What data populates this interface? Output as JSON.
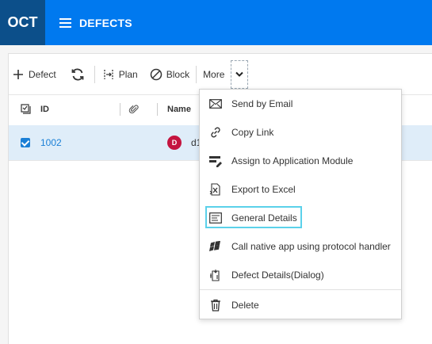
{
  "header": {
    "app_logo": "OCT",
    "module_title": "DEFECTS",
    "brand_color": "#0079ef",
    "logo_bg": "#0c4f8a"
  },
  "toolbar": {
    "add_label": "Defect",
    "plan_label": "Plan",
    "block_label": "Block",
    "more_label": "More"
  },
  "grid": {
    "columns": [
      "ID",
      "Name"
    ],
    "rows": [
      {
        "id": "1002",
        "avatar_initial": "D",
        "name_partial": "d1",
        "checked": true
      }
    ]
  },
  "more_menu": {
    "items": [
      {
        "label": "Send by Email",
        "icon": "envelope-icon"
      },
      {
        "label": "Copy Link",
        "icon": "link-icon"
      },
      {
        "label": "Assign to Application Module",
        "icon": "assign-module-icon"
      },
      {
        "label": "Export to Excel",
        "icon": "excel-export-icon"
      },
      {
        "label": "General Details",
        "icon": "details-icon"
      },
      {
        "label": "Call native app using protocol handler",
        "icon": "windows-icon"
      },
      {
        "label": "Defect Details(Dialog)",
        "icon": "dialog-details-icon"
      },
      {
        "label": "Delete",
        "icon": "trash-icon"
      }
    ],
    "focused_item": "General Details",
    "focus_color": "#5bd1ea"
  },
  "colors": {
    "selected_row": "#dfedf9",
    "link": "#1a7fd6",
    "avatar": "#c4143f"
  }
}
